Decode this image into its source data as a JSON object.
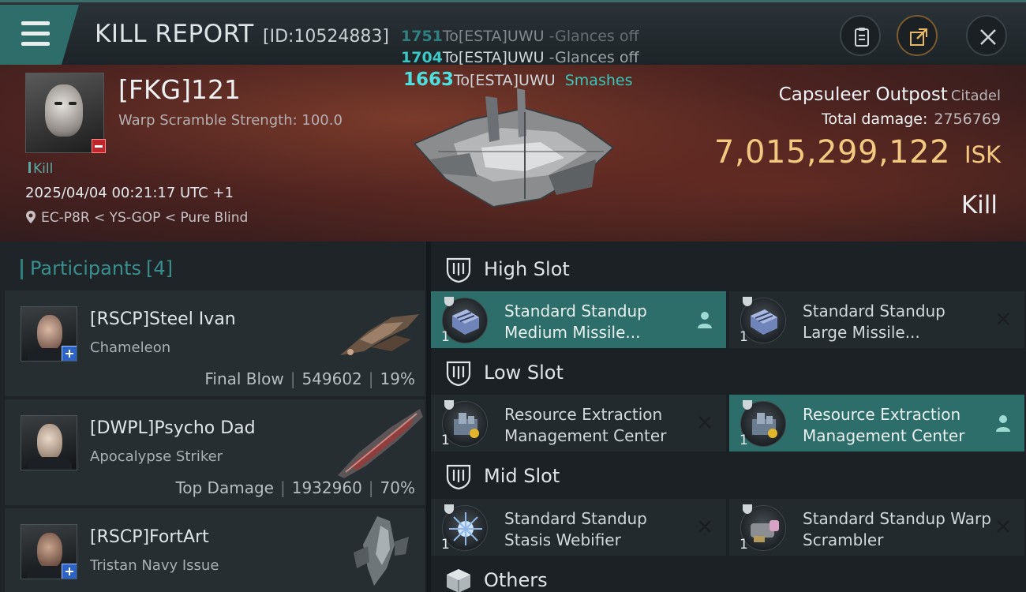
{
  "header": {
    "title": "KILL REPORT",
    "report_id": "[ID:10524883]"
  },
  "damage_log": [
    {
      "amount": "1751",
      "target": "To[ESTA]UWU",
      "type": "-Glances off"
    },
    {
      "amount": "1704",
      "target": "To[ESTA]UWU",
      "type": "-Glances off"
    },
    {
      "amount": "1663",
      "target": "To[ESTA]UWU",
      "type": "Smashes"
    }
  ],
  "victim": {
    "name": "[FKG]121",
    "warp_scramble": "Warp Scramble Strength: 100.0",
    "result_tag": "Kill",
    "datetime": "2025/04/04 00:21:17 UTC +1",
    "location": "EC-P8R < YS-GOP < Pure Blind"
  },
  "structure": {
    "name": "Capsuleer Outpost",
    "type": "Citadel",
    "total_damage_label": "Total damage:",
    "total_damage": "2756769",
    "isk_value": "7,015,299,122",
    "currency": "ISK",
    "result": "Kill"
  },
  "participants": {
    "title": "Participants",
    "count": "[4]",
    "items": [
      {
        "name": "[RSCP]Steel Ivan",
        "ship": "Chameleon",
        "role": "Final Blow",
        "damage": "549602",
        "percent": "19%"
      },
      {
        "name": "[DWPL]Psycho Dad",
        "ship": "Apocalypse Striker",
        "role": "Top Damage",
        "damage": "1932960",
        "percent": "70%"
      },
      {
        "name": "[RSCP]FortArt",
        "ship": "Tristan Navy Issue",
        "role": "",
        "damage": "",
        "percent": ""
      }
    ]
  },
  "fitting": {
    "high_slot": {
      "label": "High Slot",
      "modules": [
        {
          "name": "Standard Standup Medium Missile...",
          "qty": "1",
          "state": "active"
        },
        {
          "name": "Standard Standup Large Missile...",
          "qty": "1",
          "state": "destroyed"
        }
      ]
    },
    "low_slot": {
      "label": "Low Slot",
      "modules": [
        {
          "name": "Resource Extraction Management Center",
          "qty": "1",
          "state": "destroyed"
        },
        {
          "name": "Resource Extraction Management Center",
          "qty": "1",
          "state": "active"
        }
      ]
    },
    "mid_slot": {
      "label": "Mid Slot",
      "modules": [
        {
          "name": "Standard Standup Stasis Webifier",
          "qty": "1",
          "state": "destroyed"
        },
        {
          "name": "Standard Standup Warp Scrambler",
          "qty": "1",
          "state": "destroyed"
        }
      ]
    },
    "others": {
      "label": "Others"
    }
  }
}
